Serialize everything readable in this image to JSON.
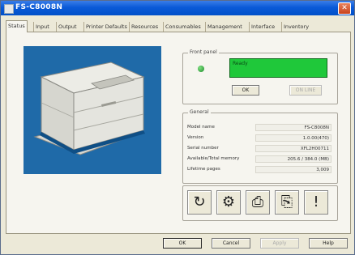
{
  "window": {
    "title": "FS-C8008N",
    "close_glyph": "✕"
  },
  "tabs": [
    {
      "label": "Status",
      "active": true
    },
    {
      "label": "Input"
    },
    {
      "label": "Output"
    },
    {
      "label": "Printer Defaults"
    },
    {
      "label": "Resources"
    },
    {
      "label": "Consumables"
    },
    {
      "label": "Management"
    },
    {
      "label": "Interface"
    },
    {
      "label": "Inventory"
    }
  ],
  "front_panel": {
    "label": "Front panel",
    "led_color": "#2ea83e",
    "display_text": "Ready",
    "display_bg": "#1fc83a",
    "ok_label": "OK",
    "online_label": "ON LINE"
  },
  "general": {
    "label": "General",
    "rows": [
      {
        "label": "Model name",
        "value": "FS-C8008N"
      },
      {
        "label": "Version",
        "value": "1.0.00(470)"
      },
      {
        "label": "Serial number",
        "value": "XFL2H00711"
      },
      {
        "label": "Available/Total memory",
        "value": "205.6 / 384.0 (MB)"
      },
      {
        "label": "Lifetime pages",
        "value": "3,009"
      }
    ]
  },
  "tools": [
    {
      "name": "refresh-icon",
      "glyph": "↻"
    },
    {
      "name": "network-icon",
      "glyph": "⚙"
    },
    {
      "name": "print-status-page-icon",
      "glyph": "⎙"
    },
    {
      "name": "print-network-page-icon",
      "glyph": "⎘"
    },
    {
      "name": "alert-icon",
      "glyph": "!"
    }
  ],
  "buttons": {
    "ok": "OK",
    "cancel": "Cancel",
    "apply": "Apply",
    "help": "Help"
  },
  "colors": {
    "titlebar": "#0a5ad8",
    "illustration_bg": "#1f6aa8"
  }
}
